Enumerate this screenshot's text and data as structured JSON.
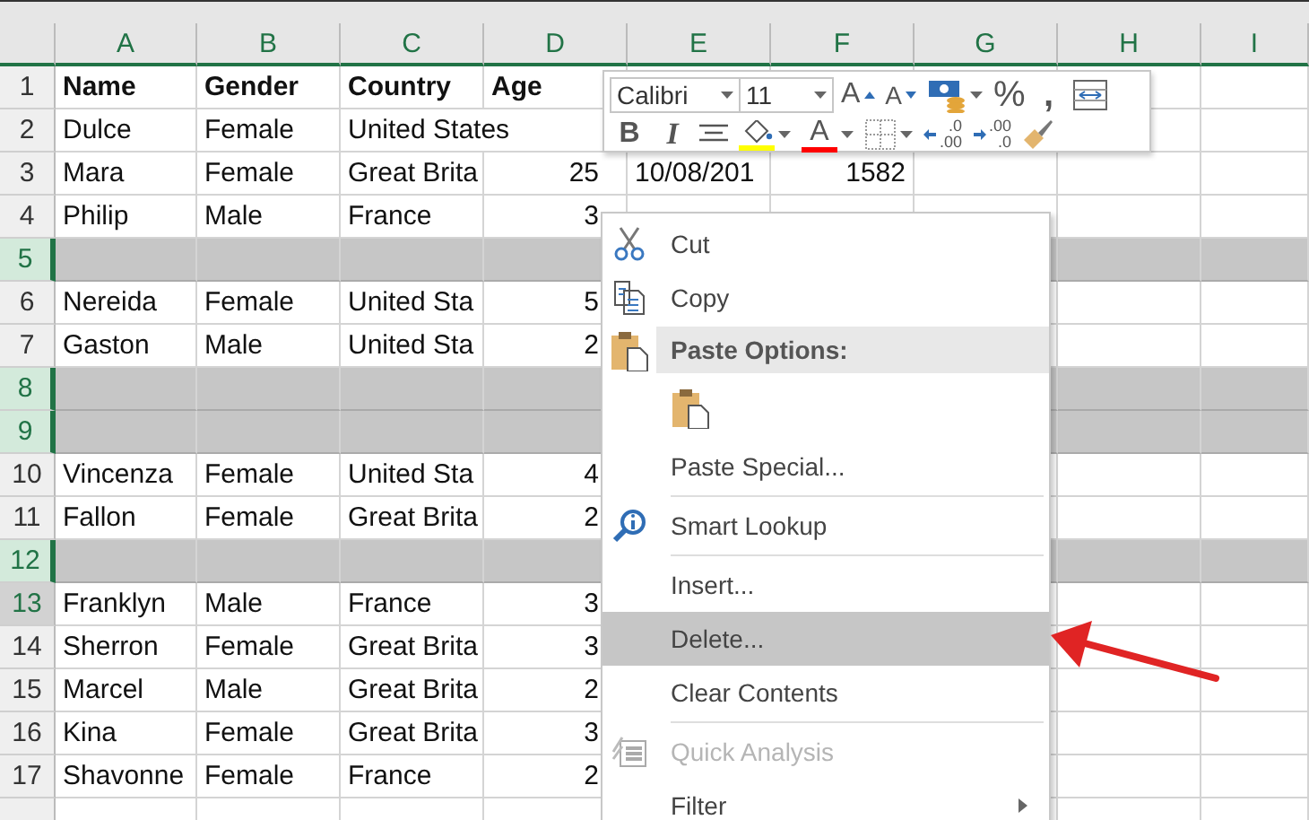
{
  "sheet": {
    "columns": [
      {
        "label": "A"
      },
      {
        "label": "B"
      },
      {
        "label": "C"
      },
      {
        "label": "D"
      },
      {
        "label": "E"
      },
      {
        "label": "F"
      },
      {
        "label": "G"
      },
      {
        "label": "H"
      },
      {
        "label": "I"
      }
    ],
    "rows": [
      {
        "header": "1",
        "kind": "heading",
        "selected": false,
        "active": false,
        "cells": {
          "a": "Name",
          "b": "Gender",
          "c": "Country",
          "d": "Age"
        }
      },
      {
        "header": "2",
        "kind": "record",
        "selected": false,
        "active": false,
        "cells": {
          "a": "Dulce",
          "b": "Female",
          "c": "United States"
        }
      },
      {
        "header": "3",
        "kind": "record",
        "selected": false,
        "active": false,
        "cells": {
          "a": "Mara",
          "b": "Female",
          "c": "Great Brita",
          "d": "25",
          "e": "10/08/201",
          "f": "1582"
        }
      },
      {
        "header": "4",
        "kind": "record",
        "selected": false,
        "active": false,
        "cells": {
          "a": "Philip",
          "b": "Male",
          "c": "France",
          "d": "3"
        }
      },
      {
        "header": "5",
        "kind": "record",
        "selected": true,
        "active": false,
        "cells": {}
      },
      {
        "header": "6",
        "kind": "record",
        "selected": false,
        "active": false,
        "cells": {
          "a": "Nereida",
          "b": "Female",
          "c": "United Sta",
          "d": "5"
        }
      },
      {
        "header": "7",
        "kind": "record",
        "selected": false,
        "active": false,
        "cells": {
          "a": "Gaston",
          "b": "Male",
          "c": "United Sta",
          "d": "2"
        }
      },
      {
        "header": "8",
        "kind": "record",
        "selected": true,
        "active": false,
        "cells": {}
      },
      {
        "header": "9",
        "kind": "record",
        "selected": true,
        "active": false,
        "cells": {}
      },
      {
        "header": "10",
        "kind": "record",
        "selected": false,
        "active": false,
        "cells": {
          "a": "Vincenza",
          "b": "Female",
          "c": "United Sta",
          "d": "4"
        }
      },
      {
        "header": "11",
        "kind": "record",
        "selected": false,
        "active": false,
        "cells": {
          "a": "Fallon",
          "b": "Female",
          "c": "Great Brita",
          "d": "2"
        }
      },
      {
        "header": "12",
        "kind": "record",
        "selected": true,
        "active": false,
        "cells": {}
      },
      {
        "header": "13",
        "kind": "record",
        "selected": false,
        "active": true,
        "cells": {
          "a": "Franklyn",
          "b": "Male",
          "c": "France",
          "d": "3"
        }
      },
      {
        "header": "14",
        "kind": "record",
        "selected": false,
        "active": false,
        "cells": {
          "a": "Sherron",
          "b": "Female",
          "c": "Great Brita",
          "d": "3"
        }
      },
      {
        "header": "15",
        "kind": "record",
        "selected": false,
        "active": false,
        "cells": {
          "a": "Marcel",
          "b": "Male",
          "c": "Great Brita",
          "d": "2"
        }
      },
      {
        "header": "16",
        "kind": "record",
        "selected": false,
        "active": false,
        "cells": {
          "a": "Kina",
          "b": "Female",
          "c": "Great Brita",
          "d": "3"
        }
      },
      {
        "header": "17",
        "kind": "record",
        "selected": false,
        "active": false,
        "cells": {
          "a": "Shavonne",
          "b": "Female",
          "c": "France",
          "d": "2"
        }
      }
    ]
  },
  "mini_toolbar": {
    "font": "Calibri",
    "size": "11",
    "grow_font": "A",
    "shrink_font": "A",
    "percent": "%",
    "comma": ",",
    "bold": "B",
    "italic": "I",
    "font_color": "A",
    "increase_decimal": [
      ".0",
      ".00"
    ],
    "decrease_decimal": [
      ".00",
      ".0"
    ]
  },
  "context_menu": {
    "items": [
      {
        "kind": "command",
        "label": "Cut",
        "selected": false,
        "disabled": false,
        "submenu": false
      },
      {
        "kind": "command",
        "label": "Copy",
        "selected": false,
        "disabled": false,
        "submenu": false
      },
      {
        "kind": "heading",
        "label": "Paste Options:"
      },
      {
        "kind": "paste_icons"
      },
      {
        "kind": "command",
        "label": "Paste Special...",
        "selected": false,
        "disabled": false,
        "submenu": false
      },
      {
        "kind": "separator"
      },
      {
        "kind": "command",
        "label": "Smart Lookup",
        "selected": false,
        "disabled": false,
        "submenu": false
      },
      {
        "kind": "separator"
      },
      {
        "kind": "command",
        "label": "Insert...",
        "selected": false,
        "disabled": false,
        "submenu": false
      },
      {
        "kind": "command",
        "label": "Delete...",
        "selected": true,
        "disabled": false,
        "submenu": false
      },
      {
        "kind": "command",
        "label": "Clear Contents",
        "selected": false,
        "disabled": false,
        "submenu": false
      },
      {
        "kind": "separator"
      },
      {
        "kind": "command",
        "label": "Quick Analysis",
        "selected": false,
        "disabled": true,
        "submenu": false
      },
      {
        "kind": "command",
        "label": "Filter",
        "selected": false,
        "disabled": false,
        "submenu": true
      }
    ]
  }
}
